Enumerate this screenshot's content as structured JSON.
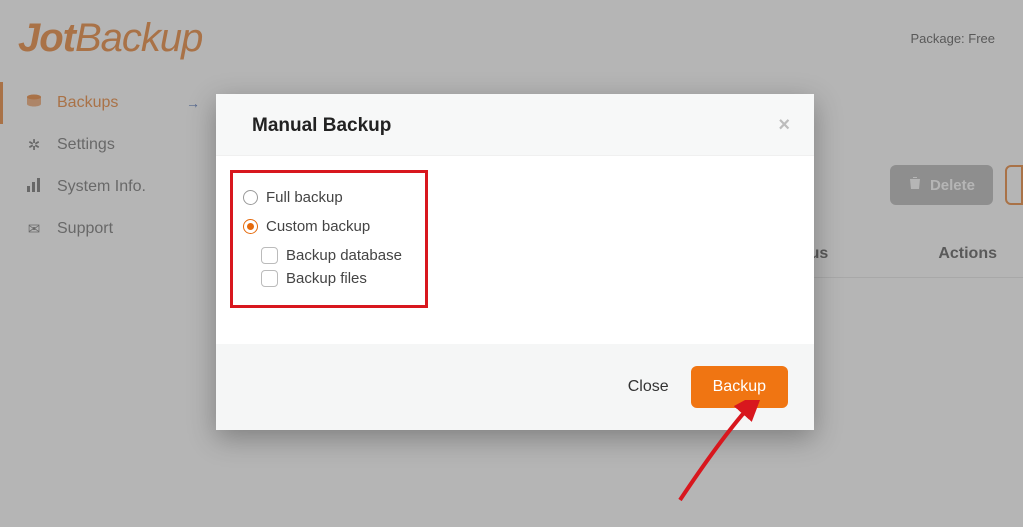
{
  "header": {
    "logo_part1": "Jot",
    "logo_part2": "Backup",
    "package_label": "Package: Free"
  },
  "sidebar": {
    "items": [
      {
        "label": "Backups",
        "icon": "disk"
      },
      {
        "label": "Settings",
        "icon": "gear"
      },
      {
        "label": "System Info.",
        "icon": "bars"
      },
      {
        "label": "Support",
        "icon": "mail"
      }
    ]
  },
  "toolbar": {
    "delete_label": "Delete"
  },
  "table": {
    "col_status": "Status",
    "col_actions": "Actions"
  },
  "modal": {
    "title": "Manual Backup",
    "option_full": "Full backup",
    "option_custom": "Custom backup",
    "check_db": "Backup database",
    "check_files": "Backup files",
    "close_label": "Close",
    "submit_label": "Backup"
  }
}
